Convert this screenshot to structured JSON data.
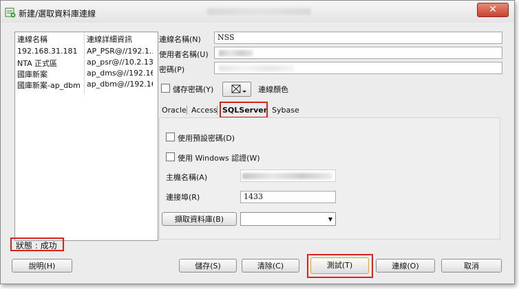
{
  "window": {
    "title": "新建/選取資料庫連線"
  },
  "connections": {
    "headers": [
      "連線名稱",
      "連線詳細資訊"
    ],
    "rows": [
      {
        "name": "192.168.31.181",
        "details": "AP_PSR@//192.1..."
      },
      {
        "name": "NTA 正式區",
        "details": "ap_psr@//10.2.13..."
      },
      {
        "name": "國庫新案",
        "details": "ap_dms@//192.16..."
      },
      {
        "name": "國庫新案-ap_dbm",
        "details": "ap_dbm@//192.16..."
      }
    ]
  },
  "status": "狀態 : 成功",
  "form": {
    "conn_name_label": "連線名稱(N)",
    "conn_name_value": "NSS",
    "user_label": "使用者名稱(U)",
    "password_label": "密碼(P)",
    "save_password_label": "儲存密碼(Y)",
    "conn_color_label": "連線顏色"
  },
  "tabs": [
    "Oracle",
    "Access",
    "SQLServer",
    "Sybase"
  ],
  "sqlserver": {
    "use_default_password_label": "使用預設密碼(D)",
    "use_windows_auth_label": "使用 Windows 認證(W)",
    "host_label": "主機名稱(A)",
    "port_label": "連接埠(R)",
    "port_value": "1433",
    "fetch_db_button": "擷取資料庫(B)"
  },
  "buttons": {
    "help": "說明(H)",
    "save": "儲存(S)",
    "clear": "清除(C)",
    "test": "測試(T)",
    "connect": "連線(O)",
    "cancel": "取消"
  }
}
